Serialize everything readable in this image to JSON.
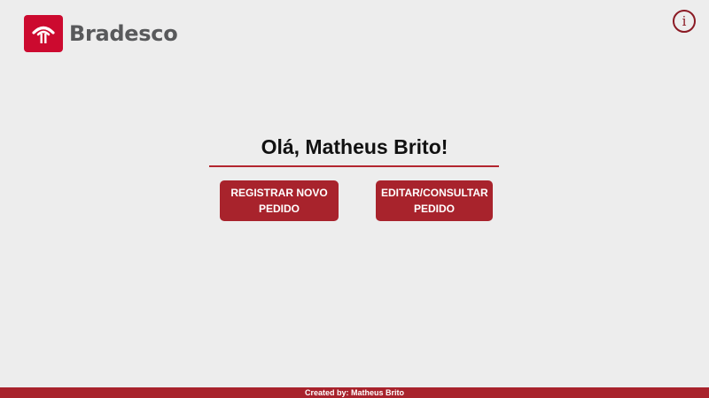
{
  "header": {
    "logo_text": "Bradesco",
    "logo_icon": "bradesco-tree-icon",
    "info_icon_glyph": "i"
  },
  "main": {
    "greeting": "Olá, Matheus Brito!",
    "register_button": "REGISTRAR NOVO\nPEDIDO",
    "edit_button": "EDITAR/CONSULTAR\nPEDIDO"
  },
  "footer": {
    "credit": "Created by: Matheus Brito"
  },
  "colors": {
    "background": "#ededed",
    "brand_red": "#cc0a2f",
    "button_red": "#a8232c",
    "info_icon": "#8b1a24",
    "logo_text": "#58595b"
  }
}
